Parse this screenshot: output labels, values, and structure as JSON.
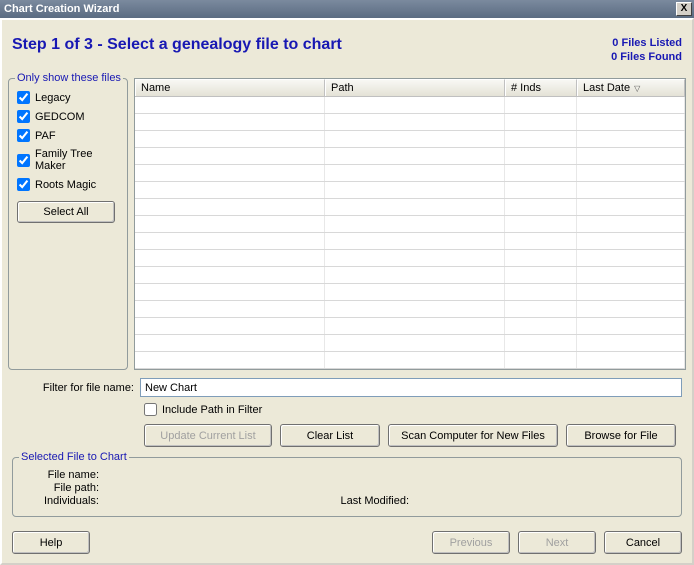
{
  "window": {
    "title": "Chart Creation Wizard",
    "close_label": "X"
  },
  "header": {
    "step_title": "Step 1 of 3 - Select a genealogy file to chart",
    "files_listed": "0 Files Listed",
    "files_found": "0 Files Found"
  },
  "filter_group": {
    "legend": "Only show these files",
    "items": [
      {
        "label": "Legacy",
        "checked": true
      },
      {
        "label": "GEDCOM",
        "checked": true
      },
      {
        "label": "PAF",
        "checked": true
      },
      {
        "label": "Family Tree Maker",
        "checked": true
      },
      {
        "label": "Roots Magic",
        "checked": true
      }
    ],
    "select_all": "Select All"
  },
  "table": {
    "columns": {
      "name": "Name",
      "path": "Path",
      "inds": "# Inds",
      "last_date": "Last Date"
    }
  },
  "filter_name": {
    "label": "Filter for file name:",
    "value": "New Chart"
  },
  "include_path": {
    "label": "Include Path in Filter",
    "checked": false
  },
  "buttons": {
    "update": "Update Current List",
    "clear": "Clear List",
    "scan": "Scan Computer for New Files",
    "browse": "Browse for File"
  },
  "selected_group": {
    "legend": "Selected File to Chart",
    "file_name_label": "File name:",
    "file_path_label": "File path:",
    "individuals_label": "Individuals:",
    "last_modified_label": "Last Modified:",
    "file_name": "",
    "file_path": "",
    "individuals": "",
    "last_modified": ""
  },
  "bottom": {
    "help": "Help",
    "previous": "Previous",
    "next": "Next",
    "cancel": "Cancel"
  }
}
